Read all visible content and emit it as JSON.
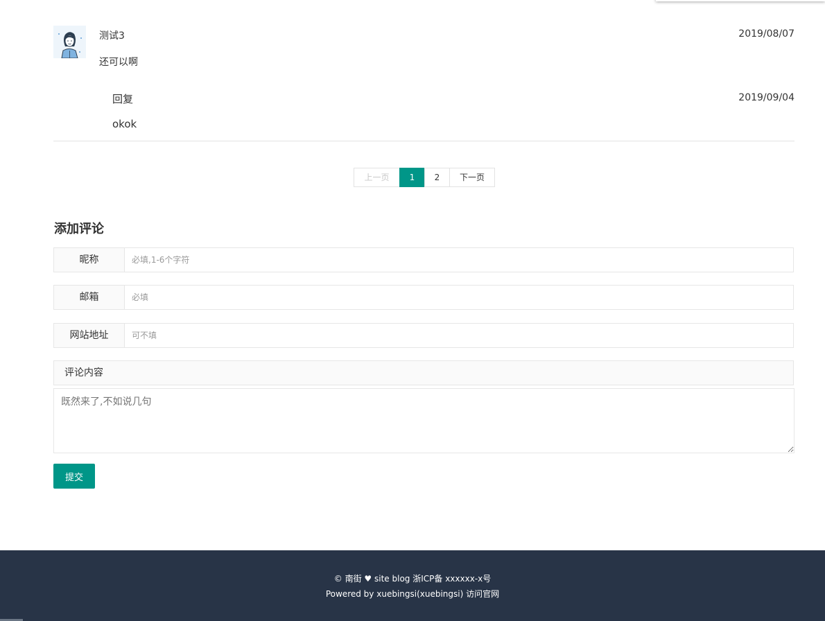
{
  "comment": {
    "author": "测试3",
    "date": "2019/08/07",
    "body": "还可以啊",
    "reply": {
      "author": "回复",
      "date": "2019/09/04",
      "body": "okok"
    }
  },
  "pagination": {
    "prev_label": "上一页",
    "pages": [
      "1",
      "2"
    ],
    "active_page": "1",
    "next_label": "下一页"
  },
  "form": {
    "title": "添加评论",
    "nickname": {
      "label": "昵称",
      "placeholder": "必填,1-6个字符",
      "value": ""
    },
    "email": {
      "label": "邮箱",
      "placeholder": "必填",
      "value": ""
    },
    "website": {
      "label": "网站地址",
      "placeholder": "可不填",
      "value": ""
    },
    "content": {
      "label": "评论内容",
      "placeholder": "既然来了,不如说几句",
      "value": ""
    },
    "submit_label": "提交"
  },
  "footer": {
    "copyright": "©",
    "site_name": "南街",
    "heart": "♥",
    "site_blog": "site blog",
    "icp": "浙ICP备 xxxxxx-x号",
    "powered_by": "Powered by",
    "author": "xuebingsi(xuebingsi)",
    "visit_link": "访问官网"
  },
  "colors": {
    "accent": "#009688",
    "footer_bg": "#283447",
    "border": "#e6e6e6"
  }
}
